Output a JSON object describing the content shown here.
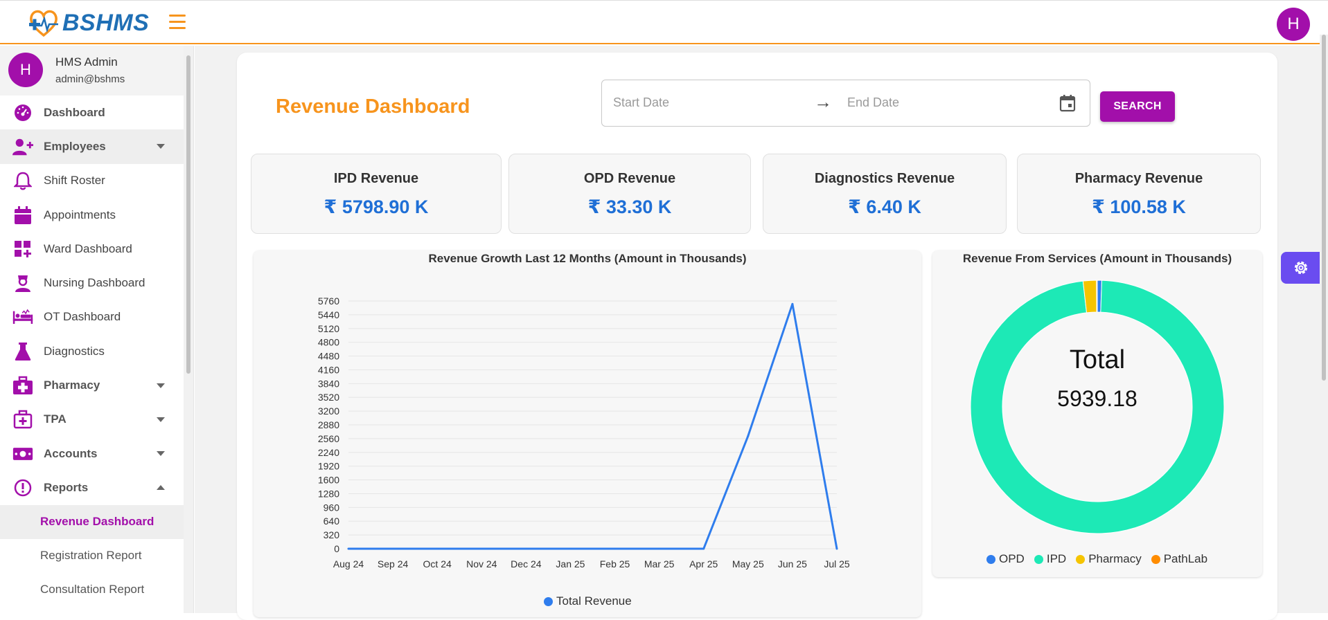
{
  "header": {
    "logo_text": "BSHMS",
    "avatar_letter": "H"
  },
  "user": {
    "avatar_letter": "H",
    "name": "HMS Admin",
    "email": "admin@bshms"
  },
  "sidebar": {
    "items": [
      {
        "label": "Dashboard",
        "icon": "dashboard-gauge-icon",
        "bold": true
      },
      {
        "label": "Employees",
        "icon": "add-user-icon",
        "bold": true,
        "caret": "down"
      },
      {
        "label": "Shift Roster",
        "icon": "bell-icon"
      },
      {
        "label": "Appointments",
        "icon": "calendar-icon"
      },
      {
        "label": "Ward Dashboard",
        "icon": "grid-plus-icon"
      },
      {
        "label": "Nursing Dashboard",
        "icon": "nurse-icon"
      },
      {
        "label": "OT Dashboard",
        "icon": "bed-icon"
      },
      {
        "label": "Diagnostics",
        "icon": "flask-icon"
      },
      {
        "label": "Pharmacy",
        "icon": "medical-bag-icon",
        "bold": true,
        "caret": "down"
      },
      {
        "label": "TPA",
        "icon": "medical-kit-icon",
        "bold": true,
        "caret": "down"
      },
      {
        "label": "Accounts",
        "icon": "cash-icon",
        "bold": true,
        "caret": "down"
      },
      {
        "label": "Reports",
        "icon": "alert-circle-icon",
        "bold": true,
        "caret": "up"
      }
    ],
    "subitems": [
      {
        "label": "Revenue Dashboard",
        "active": true
      },
      {
        "label": "Registration Report"
      },
      {
        "label": "Consultation Report"
      }
    ]
  },
  "main": {
    "title": "Revenue Dashboard",
    "date_range": {
      "start_placeholder": "Start Date",
      "arrow": "→",
      "end_placeholder": "End Date"
    },
    "search_label": "SEARCH",
    "stats": [
      {
        "label": "IPD Revenue",
        "value": "₹ 5798.90 K"
      },
      {
        "label": "OPD Revenue",
        "value": "₹ 33.30 K"
      },
      {
        "label": "Diagnostics Revenue",
        "value": "₹ 6.40 K"
      },
      {
        "label": "Pharmacy Revenue",
        "value": "₹ 100.58 K"
      }
    ]
  },
  "chart_data": [
    {
      "type": "line",
      "title": "Revenue Growth Last 12 Months (Amount in Thousands)",
      "categories": [
        "Aug 24",
        "Sep 24",
        "Oct 24",
        "Nov 24",
        "Dec 24",
        "Jan 25",
        "Feb 25",
        "Mar 25",
        "Apr 25",
        "May 25",
        "Jun 25",
        "Jul 25"
      ],
      "series": [
        {
          "name": "Total Revenue",
          "color": "#2f7ded",
          "values": [
            0,
            0,
            0,
            0,
            0,
            0,
            0,
            0,
            0,
            2620,
            5690,
            0
          ]
        }
      ],
      "yticks": [
        0,
        320,
        640,
        960,
        1280,
        1600,
        1920,
        2240,
        2560,
        2880,
        3200,
        3520,
        3840,
        4160,
        4480,
        4800,
        5120,
        5440,
        5760
      ],
      "ylim": [
        0,
        5760
      ],
      "grid": true,
      "legend": "bottom"
    },
    {
      "type": "pie",
      "subtype": "doughnut",
      "title": "Revenue From Services (Amount in Thousands)",
      "center_label": "Total",
      "center_value": "5939.18",
      "slices": [
        {
          "label": "OPD",
          "value": 33.3,
          "color": "#2f7ded"
        },
        {
          "label": "IPD",
          "value": 5798.9,
          "color": "#1de9b6"
        },
        {
          "label": "Pharmacy",
          "value": 100.58,
          "color": "#f5c400"
        },
        {
          "label": "PathLab",
          "value": 6.4,
          "color": "#ff8c00"
        }
      ],
      "legend": "bottom"
    }
  ],
  "colors": {
    "brand_orange": "#f7941d",
    "brand_purple": "#a20faa",
    "value_blue": "#1f6fd6",
    "gear_tab": "#6a4cf0"
  }
}
